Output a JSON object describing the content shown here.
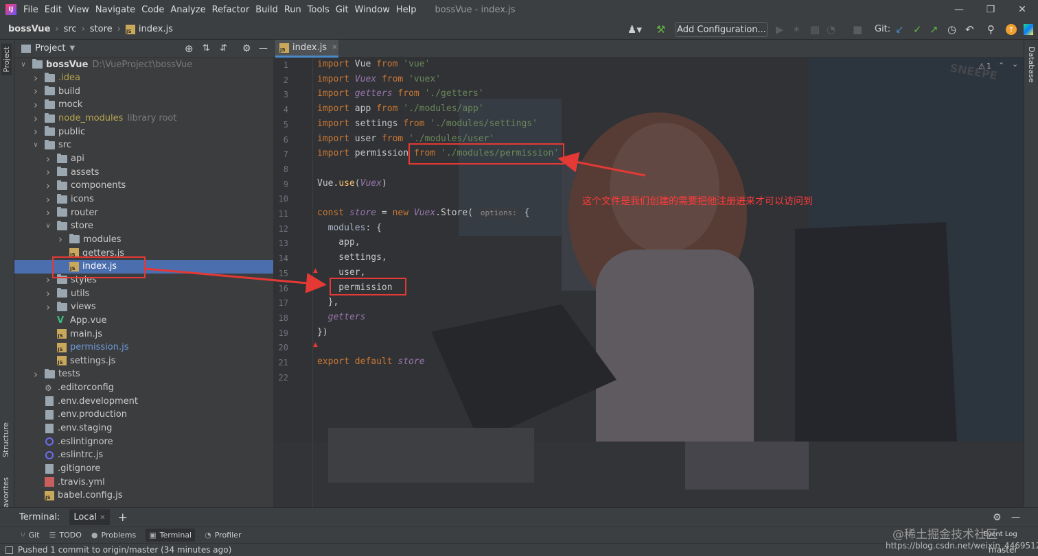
{
  "menu": {
    "items": [
      "File",
      "Edit",
      "View",
      "Navigate",
      "Code",
      "Analyze",
      "Refactor",
      "Build",
      "Run",
      "Tools",
      "Git",
      "Window",
      "Help"
    ],
    "window_title": "bossVue - index.js"
  },
  "breadcrumb": [
    "bossVue",
    "src",
    "store",
    "index.js"
  ],
  "toolbar": {
    "add_configuration": "Add Configuration...",
    "git_label": "Git:"
  },
  "left_strip": {
    "project": "Project",
    "structure": "Structure",
    "favorites": "Favorites"
  },
  "right_strip": {
    "database": "Database"
  },
  "project_panel": {
    "title": "Project"
  },
  "tree": [
    {
      "label": "bossVue",
      "extra": "D:\\VueProject\\bossVue",
      "icon": "folder",
      "depth": 0,
      "arrow": "open",
      "color": "#dcdcdc",
      "bold": true
    },
    {
      "label": ".idea",
      "icon": "folder",
      "depth": 1,
      "arrow": "closed",
      "color": "#b8a54e"
    },
    {
      "label": "build",
      "icon": "folder",
      "depth": 1,
      "arrow": "closed"
    },
    {
      "label": "mock",
      "icon": "folder",
      "depth": 1,
      "arrow": "closed"
    },
    {
      "label": "node_modules",
      "extra": "library root",
      "icon": "folder",
      "depth": 1,
      "arrow": "closed",
      "color": "#b8a54e"
    },
    {
      "label": "public",
      "icon": "folder",
      "depth": 1,
      "arrow": "closed"
    },
    {
      "label": "src",
      "icon": "folder",
      "depth": 1,
      "arrow": "open"
    },
    {
      "label": "api",
      "icon": "folder",
      "depth": 2,
      "arrow": "closed"
    },
    {
      "label": "assets",
      "icon": "folder",
      "depth": 2,
      "arrow": "closed"
    },
    {
      "label": "components",
      "icon": "folder",
      "depth": 2,
      "arrow": "closed"
    },
    {
      "label": "icons",
      "icon": "folder",
      "depth": 2,
      "arrow": "closed"
    },
    {
      "label": "router",
      "icon": "folder",
      "depth": 2,
      "arrow": "closed"
    },
    {
      "label": "store",
      "icon": "folder",
      "depth": 2,
      "arrow": "open"
    },
    {
      "label": "modules",
      "icon": "folder",
      "depth": 3,
      "arrow": "closed"
    },
    {
      "label": "getters.js",
      "icon": "js",
      "depth": 3,
      "arrow": "none"
    },
    {
      "label": "index.js",
      "icon": "js",
      "depth": 3,
      "arrow": "none",
      "selected": true
    },
    {
      "label": "styles",
      "icon": "folder",
      "depth": 2,
      "arrow": "closed"
    },
    {
      "label": "utils",
      "icon": "folder",
      "depth": 2,
      "arrow": "closed"
    },
    {
      "label": "views",
      "icon": "folder",
      "depth": 2,
      "arrow": "closed"
    },
    {
      "label": "App.vue",
      "icon": "vue",
      "depth": 2,
      "arrow": "none"
    },
    {
      "label": "main.js",
      "icon": "js",
      "depth": 2,
      "arrow": "none"
    },
    {
      "label": "permission.js",
      "icon": "js",
      "depth": 2,
      "arrow": "none",
      "color": "#6f9bd8"
    },
    {
      "label": "settings.js",
      "icon": "js",
      "depth": 2,
      "arrow": "none"
    },
    {
      "label": "tests",
      "icon": "folder",
      "depth": 1,
      "arrow": "closed"
    },
    {
      "label": ".editorconfig",
      "icon": "gear",
      "depth": 1,
      "arrow": "none"
    },
    {
      "label": ".env.development",
      "icon": "file",
      "depth": 1,
      "arrow": "none"
    },
    {
      "label": ".env.production",
      "icon": "file",
      "depth": 1,
      "arrow": "none"
    },
    {
      "label": ".env.staging",
      "icon": "file",
      "depth": 1,
      "arrow": "none"
    },
    {
      "label": ".eslintignore",
      "icon": "ring",
      "depth": 1,
      "arrow": "none"
    },
    {
      "label": ".eslintrc.js",
      "icon": "ring",
      "depth": 1,
      "arrow": "none"
    },
    {
      "label": ".gitignore",
      "icon": "file",
      "depth": 1,
      "arrow": "none"
    },
    {
      "label": ".travis.yml",
      "icon": "yml",
      "depth": 1,
      "arrow": "none"
    },
    {
      "label": "babel.config.js",
      "icon": "js",
      "depth": 1,
      "arrow": "none"
    }
  ],
  "editor_tab": {
    "label": "index.js"
  },
  "inspection": {
    "count": "1"
  },
  "code_lines": [
    [
      [
        "kw",
        "import"
      ],
      [
        "p",
        " Vue "
      ],
      [
        "kw",
        "from"
      ],
      [
        "p",
        " "
      ],
      [
        "str",
        "'vue'"
      ]
    ],
    [
      [
        "kw",
        "import"
      ],
      [
        "p",
        " "
      ],
      [
        "it",
        "Vuex"
      ],
      [
        "p",
        " "
      ],
      [
        "kw",
        "from"
      ],
      [
        "p",
        " "
      ],
      [
        "str",
        "'vuex'"
      ]
    ],
    [
      [
        "kw",
        "import"
      ],
      [
        "p",
        " "
      ],
      [
        "it",
        "getters"
      ],
      [
        "p",
        " "
      ],
      [
        "kw",
        "from"
      ],
      [
        "p",
        " "
      ],
      [
        "str",
        "'./getters'"
      ]
    ],
    [
      [
        "kw",
        "import"
      ],
      [
        "p",
        " app "
      ],
      [
        "kw",
        "from"
      ],
      [
        "p",
        " "
      ],
      [
        "str",
        "'./modules/app'"
      ]
    ],
    [
      [
        "kw",
        "import"
      ],
      [
        "p",
        " settings "
      ],
      [
        "kw",
        "from"
      ],
      [
        "p",
        " "
      ],
      [
        "str",
        "'./modules/settings'"
      ]
    ],
    [
      [
        "kw",
        "import"
      ],
      [
        "p",
        " user "
      ],
      [
        "kw",
        "from"
      ],
      [
        "p",
        " "
      ],
      [
        "str",
        "'./modules/user'"
      ]
    ],
    [
      [
        "kw",
        "import"
      ],
      [
        "p",
        " permission "
      ],
      [
        "kw",
        "from"
      ],
      [
        "p",
        " "
      ],
      [
        "str",
        "'./modules/permission'"
      ]
    ],
    [],
    [
      [
        "p",
        "Vue."
      ],
      [
        "fn",
        "use"
      ],
      [
        "p",
        "("
      ],
      [
        "it",
        "Vuex"
      ],
      [
        "p",
        ")"
      ]
    ],
    [],
    [
      [
        "kw",
        "const"
      ],
      [
        "p",
        " "
      ],
      [
        "it",
        "store"
      ],
      [
        "p",
        " = "
      ],
      [
        "kw",
        "new"
      ],
      [
        "p",
        " "
      ],
      [
        "it",
        "Vuex"
      ],
      [
        "p",
        ".Store( "
      ],
      [
        "hint",
        "options:"
      ],
      [
        "p",
        " {"
      ]
    ],
    [
      [
        "p",
        "  "
      ],
      [
        "prop",
        "modules"
      ],
      [
        "p",
        ": {"
      ]
    ],
    [
      [
        "p",
        "    app,"
      ]
    ],
    [
      [
        "p",
        "    settings,"
      ]
    ],
    [
      [
        "p",
        "    user,"
      ]
    ],
    [
      [
        "p",
        "    permission"
      ]
    ],
    [
      [
        "p",
        "  },"
      ]
    ],
    [
      [
        "p",
        "  "
      ],
      [
        "it",
        "getters"
      ]
    ],
    [
      [
        "p",
        "})"
      ]
    ],
    [],
    [
      [
        "kw",
        "export default"
      ],
      [
        "p",
        " "
      ],
      [
        "it",
        "store"
      ]
    ],
    []
  ],
  "annotation": "这个文件是我们创建的需要把他注册进来才可以访问到",
  "terminal": {
    "label": "Terminal:",
    "tab": "Local"
  },
  "tool_windows": [
    "Git",
    "TODO",
    "Problems",
    "Terminal",
    "Profiler"
  ],
  "status": {
    "message": "Pushed 1 commit to origin/master (34 minutes ago)",
    "branch": "master",
    "event_log": "Event Log"
  },
  "watermark": {
    "line1": "@稀土掘金技术社区",
    "line2": "https://blog.csdn.net/weixin_44695125"
  }
}
